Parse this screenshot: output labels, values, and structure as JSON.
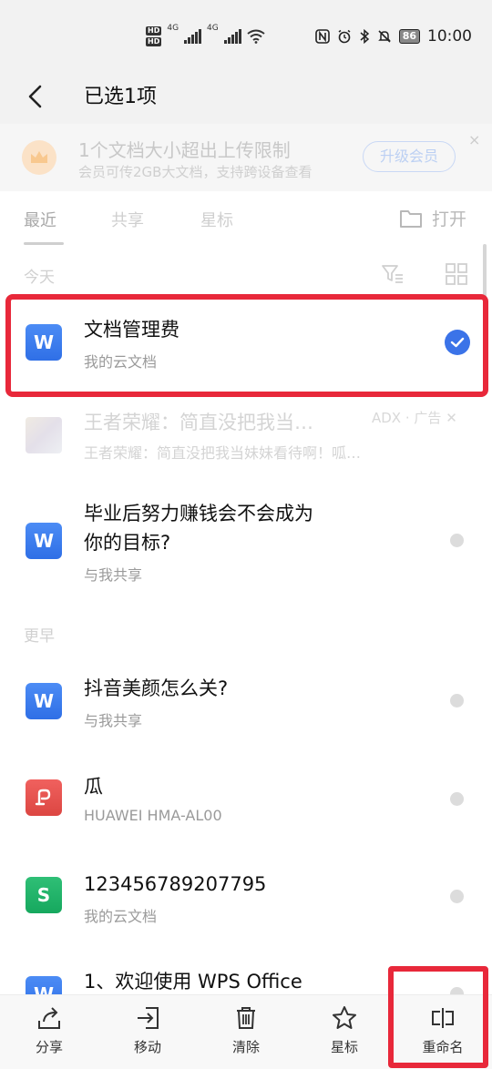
{
  "status_bar": {
    "hd1": "HD",
    "hd2": "HD",
    "net1": "4G",
    "net2": "4G",
    "battery": "86",
    "time": "10:00"
  },
  "header": {
    "title": "已选1项"
  },
  "promo": {
    "title": "1个文档大小超出上传限制",
    "subtitle": "会员可传2GB大文档，支持跨设备查看",
    "button": "升级会员",
    "close": "×"
  },
  "tabs": [
    {
      "label": "最近",
      "active": true
    },
    {
      "label": "共享",
      "active": false
    },
    {
      "label": "星标",
      "active": false
    }
  ],
  "open_label": "打开",
  "sections": {
    "today": "今天",
    "earlier": "更早"
  },
  "files_today": [
    {
      "title": "文档管理费",
      "subtitle": "我的云文档",
      "icon": "W",
      "type": "word",
      "selected": true
    }
  ],
  "ad": {
    "title": "王者荣耀：简直没把我当…",
    "subtitle": "王者荣耀：简直没把我当妹妹看待啊！呱…",
    "label": "ADX · 广告"
  },
  "file_shared": {
    "title_line1": "毕业后努力赚钱会不会成为",
    "title_line2": "你的目标?",
    "subtitle": "与我共享",
    "icon": "W"
  },
  "files_earlier": [
    {
      "title": "抖音美颜怎么关?",
      "subtitle": "与我共享",
      "icon": "W",
      "type": "word"
    },
    {
      "title": "瓜",
      "subtitle": "HUAWEI HMA-AL00",
      "icon": "P",
      "type": "pdf"
    },
    {
      "title": "123456789207795",
      "subtitle": "我的云文档",
      "icon": "S",
      "type": "sheet"
    },
    {
      "title": "1、欢迎使用 WPS Office",
      "subtitle": "",
      "icon": "W",
      "type": "word"
    }
  ],
  "bottom_bar": [
    {
      "label": "分享",
      "icon": "share-icon"
    },
    {
      "label": "移动",
      "icon": "move-icon"
    },
    {
      "label": "清除",
      "icon": "trash-icon"
    },
    {
      "label": "星标",
      "icon": "star-icon"
    },
    {
      "label": "重命名",
      "icon": "rename-icon"
    }
  ],
  "colors": {
    "accent": "#3b73e8",
    "highlight": "#e8283a"
  }
}
